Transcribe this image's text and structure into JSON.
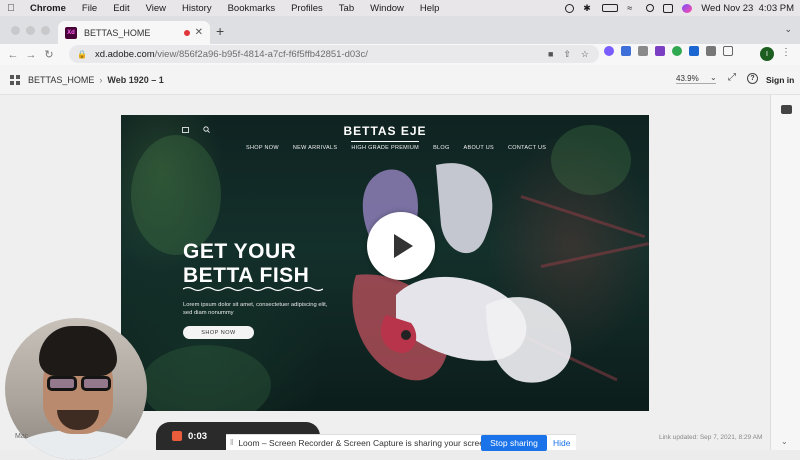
{
  "menubar": {
    "app": "Chrome",
    "items": [
      "File",
      "Edit",
      "View",
      "History",
      "Bookmarks",
      "Profiles",
      "Tab",
      "Window",
      "Help"
    ],
    "datetime": "Wed Nov 23  4:03 PM"
  },
  "tab": {
    "title": "BETTAS_HOME",
    "favicon": "Xd"
  },
  "omnibox": {
    "host": "xd.adobe.com",
    "path": "/view/856f2a96-b95f-4814-a7cf-f6f5ffb42851-d03c/"
  },
  "profile": {
    "initial": "I"
  },
  "xd": {
    "project": "BETTAS_HOME",
    "artboard": "Web 1920 – 1",
    "zoom": "43.9%",
    "signin": "Sign in",
    "help": "?"
  },
  "hero": {
    "brand": "BETTAS EJE",
    "nav": [
      "SHOP NOW",
      "NEW ARRIVALS",
      "HIGH GRADE PREMIUM",
      "BLOG",
      "ABOUT US",
      "CONTACT US"
    ],
    "headline_line1": "GET YOUR",
    "headline_line2": "BETTA FISH",
    "subtext": "Lorem ipsum dolor sit amet, consectetuer adipiscing elit, sed diam nonummy",
    "cta": "SHOP NOW"
  },
  "loom": {
    "timer": "0:03",
    "mac_label": "Mac",
    "share_message": "Loom – Screen Recorder & Screen Capture is sharing your screen.",
    "stop_label": "Stop sharing",
    "hide_label": "Hide"
  },
  "footer": {
    "link_updated": "Link updated: Sep 7, 2021, 8:29 AM"
  },
  "colors": {
    "accent_blue": "#1a73e8",
    "xd_brand": "#470137",
    "hero_bg": "#14302b",
    "loom_stop": "#e95d3d"
  }
}
